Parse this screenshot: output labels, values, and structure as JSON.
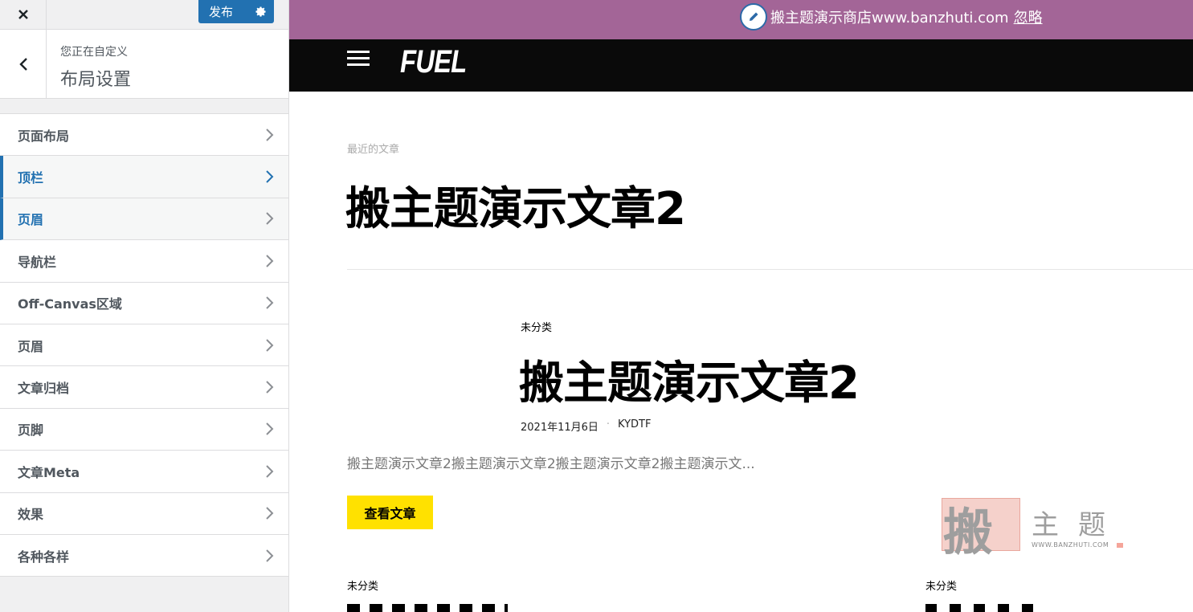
{
  "customizer": {
    "publish_label": "发布",
    "customizing_label": "您正在自定义",
    "section_title": "布局设置",
    "menu_items": [
      {
        "label": "页面布局"
      },
      {
        "label": "顶栏"
      },
      {
        "label": "页眉"
      },
      {
        "label": "导航栏"
      },
      {
        "label": "Off-Canvas区域"
      },
      {
        "label": "页眉"
      },
      {
        "label": "文章归档"
      },
      {
        "label": "页脚"
      },
      {
        "label": "文章Meta"
      },
      {
        "label": "效果"
      },
      {
        "label": "各种各样"
      }
    ]
  },
  "notice": {
    "text": "搬主题演示商店www.banzhuti.com",
    "dismiss": "忽略"
  },
  "site": {
    "logo": "FUEL"
  },
  "archive": {
    "label": "最近的文章",
    "title": "搬主题演示文章2"
  },
  "post": {
    "category": "未分类",
    "title": "搬主题演示文章2",
    "date": "2021年11月6日",
    "author": "KYDTF",
    "excerpt": "搬主题演示文章2搬主题演示文章2搬主题演示文章2搬主题演示文...",
    "read_more": "查看文章"
  },
  "watermark": {
    "char1": "搬",
    "chars": "主题",
    "url": "WWW.BANZHUTI.COM"
  },
  "next_posts": [
    {
      "category": "未分类"
    },
    {
      "category": "未分类"
    }
  ],
  "colors": {
    "accent": "#2271b1",
    "notice_bg": "#a36597",
    "button_yellow": "#ffe100"
  },
  "icons": [
    "close-icon",
    "gear-icon",
    "back-chevron-icon",
    "chevron-right-icon",
    "pencil-icon",
    "hamburger-icon"
  ]
}
